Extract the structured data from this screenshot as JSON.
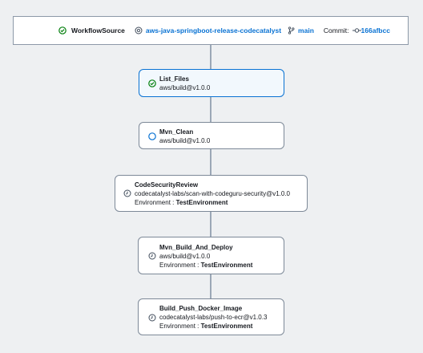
{
  "source": {
    "title": "WorkflowSource",
    "repository": "aws-java-springboot-release-codecatalyst",
    "branch": "main",
    "commit_label": "Commit:",
    "commit": "166afbcc"
  },
  "nodes": [
    {
      "name": "List_Files",
      "action": "aws/build@v1.0.0",
      "status": "succeeded",
      "icon": "check-circle-icon"
    },
    {
      "name": "Mvn_Clean",
      "action": "aws/build@v1.0.0",
      "status": "in-progress",
      "icon": "empty-circle-icon"
    },
    {
      "name": "CodeSecurityReview",
      "action": "codecatalyst-labs/scan-with-codeguru-security@v1.0.0",
      "env_label": "Environment",
      "env_sep": ":",
      "env_value": "TestEnvironment",
      "status": "pending",
      "icon": "clock-icon"
    },
    {
      "name": "Mvn_Build_And_Deploy",
      "action": "aws/build@v1.0.0",
      "env_label": "Environment",
      "env_sep": ":",
      "env_value": "TestEnvironment",
      "status": "pending",
      "icon": "clock-icon"
    },
    {
      "name": "Build_Push_Docker_Image",
      "action": "codecatalyst-labs/push-to-ecr@v1.0.3",
      "env_label": "Environment",
      "env_sep": ":",
      "env_value": "TestEnvironment",
      "status": "pending",
      "icon": "clock-icon"
    }
  ],
  "colors": {
    "success": "#037f0c",
    "link": "#0972d3",
    "in_progress": "#0972d3",
    "pending": "#414d5c",
    "connector": "#9ba7b6"
  }
}
